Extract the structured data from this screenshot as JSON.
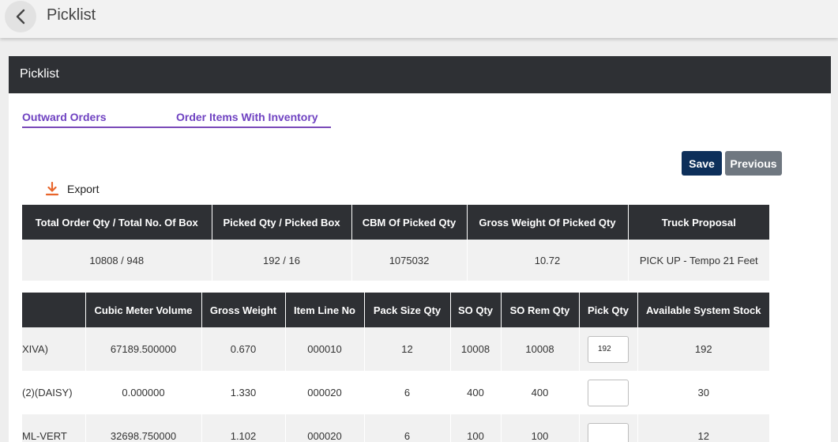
{
  "topbar": {
    "title": "Picklist",
    "back_icon": "chevron-left-icon"
  },
  "card": {
    "title": "Picklist"
  },
  "tabs": [
    {
      "label": "Outward Orders"
    },
    {
      "label": "Order Items With Inventory"
    }
  ],
  "actions": {
    "save_label": "Save",
    "previous_label": "Previous"
  },
  "export": {
    "label": "Export",
    "icon": "download-icon",
    "icon_color": "#e8652b"
  },
  "summary": {
    "headers": [
      "Total Order Qty / Total No. Of Box",
      "Picked Qty / Picked Box",
      "CBM Of Picked Qty",
      "Gross Weight Of Picked Qty",
      "Truck Proposal"
    ],
    "row": [
      "10808 / 948",
      "192 / 16",
      "1075032",
      "10.72",
      "PICK UP - Tempo 21 Feet"
    ]
  },
  "items": {
    "headers": [
      "",
      "Cubic Meter Volume",
      "Gross Weight",
      "Item Line No",
      "Pack Size Qty",
      "SO Qty",
      "SO Rem Qty",
      "Pick Qty",
      "Available System Stock"
    ],
    "rows": [
      {
        "name": "XIVA)",
        "cbm": "67189.500000",
        "gross_weight": "0.670",
        "line_no": "000010",
        "pack_size": "12",
        "so_qty": "10008",
        "so_rem_qty": "10008",
        "pick_qty": "192",
        "stock": "192"
      },
      {
        "name": "(2)(DAISY)",
        "cbm": "0.000000",
        "gross_weight": "1.330",
        "line_no": "000020",
        "pack_size": "6",
        "so_qty": "400",
        "so_rem_qty": "400",
        "pick_qty": "",
        "stock": "30"
      },
      {
        "name": "ML-VERT",
        "cbm": "32698.750000",
        "gross_weight": "1.102",
        "line_no": "000020",
        "pack_size": "6",
        "so_qty": "100",
        "so_rem_qty": "100",
        "pick_qty": "",
        "stock": "12"
      }
    ]
  },
  "colors": {
    "header_bg": "#2e3034",
    "tab_accent": "#6f42c1",
    "save_bg": "#0d2f5a",
    "previous_bg": "#6f7780"
  }
}
